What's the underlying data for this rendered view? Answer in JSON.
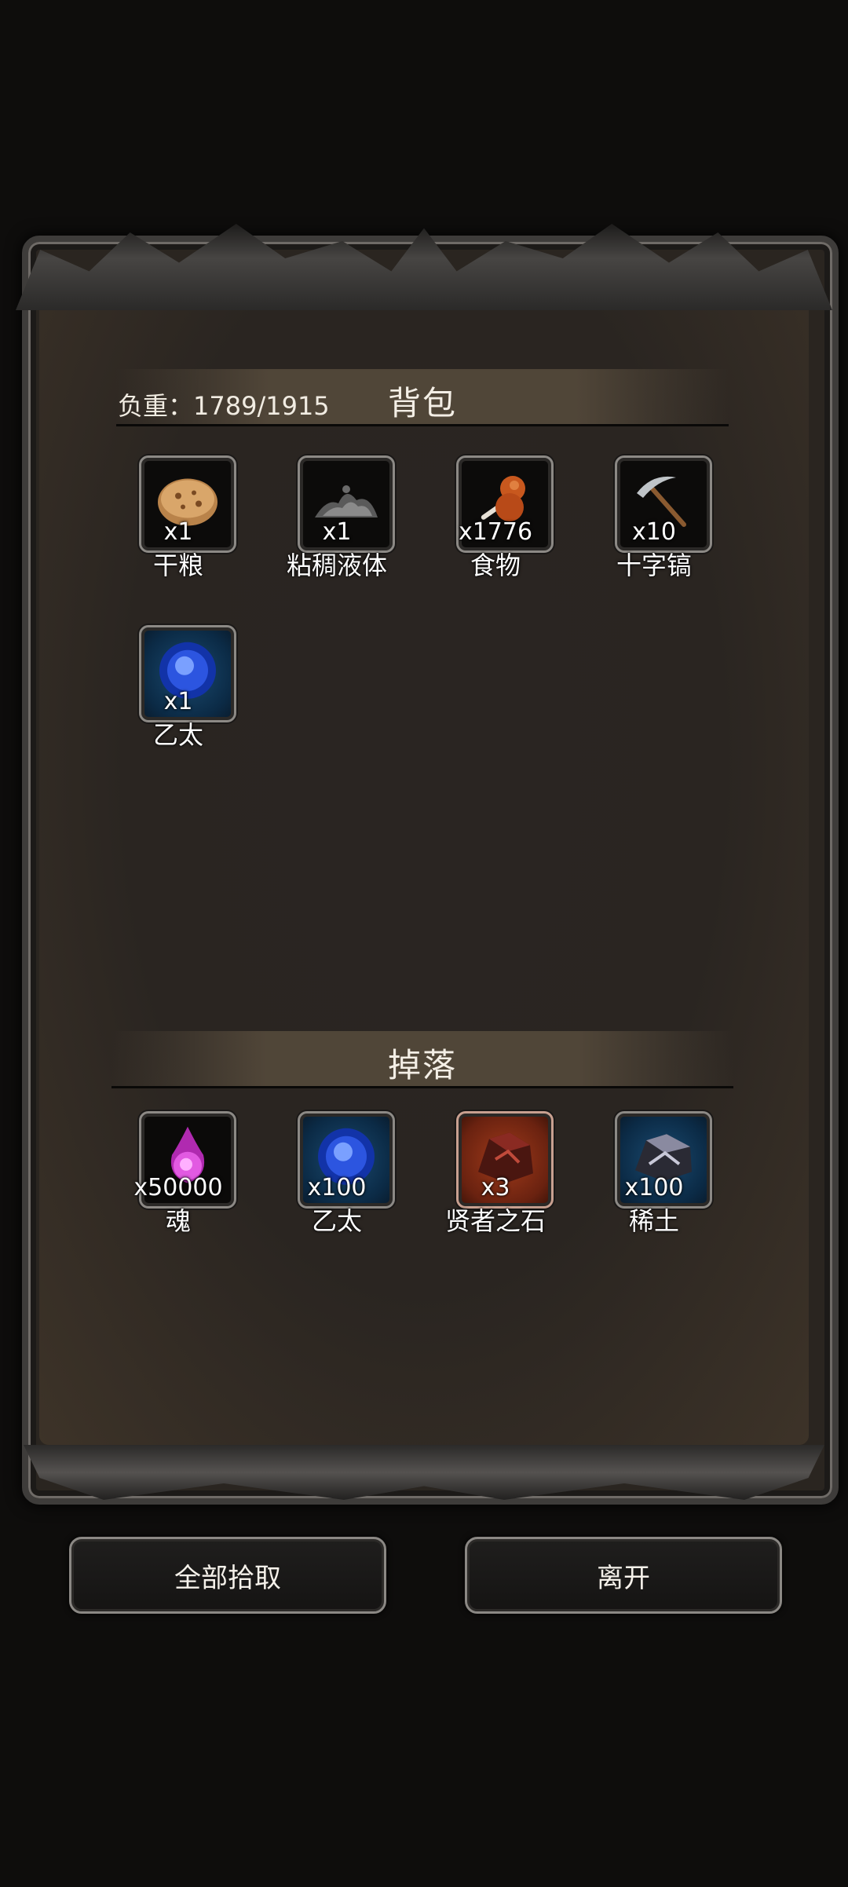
{
  "bag": {
    "title": "背包",
    "weight_label": "负重：1789/1915",
    "items": [
      {
        "name": "干粮",
        "qty": "x1",
        "icon": "dry-food-icon"
      },
      {
        "name": "粘稠液体",
        "qty": "x1",
        "icon": "viscous-liquid-icon"
      },
      {
        "name": "食物",
        "qty": "x1776",
        "icon": "meat-food-icon"
      },
      {
        "name": "十字镐",
        "qty": "x10",
        "icon": "pickaxe-icon"
      },
      {
        "name": "乙太",
        "qty": "x1",
        "icon": "ether-orb-icon"
      }
    ]
  },
  "drops": {
    "title": "掉落",
    "items": [
      {
        "name": "魂",
        "qty": "x50000",
        "icon": "soul-icon"
      },
      {
        "name": "乙太",
        "qty": "x100",
        "icon": "ether-orb-icon"
      },
      {
        "name": "贤者之石",
        "qty": "x3",
        "icon": "philosopher-stone-icon"
      },
      {
        "name": "稀土",
        "qty": "x100",
        "icon": "rare-earth-icon"
      }
    ]
  },
  "buttons": {
    "pickup_all": "全部拾取",
    "leave": "离开"
  }
}
